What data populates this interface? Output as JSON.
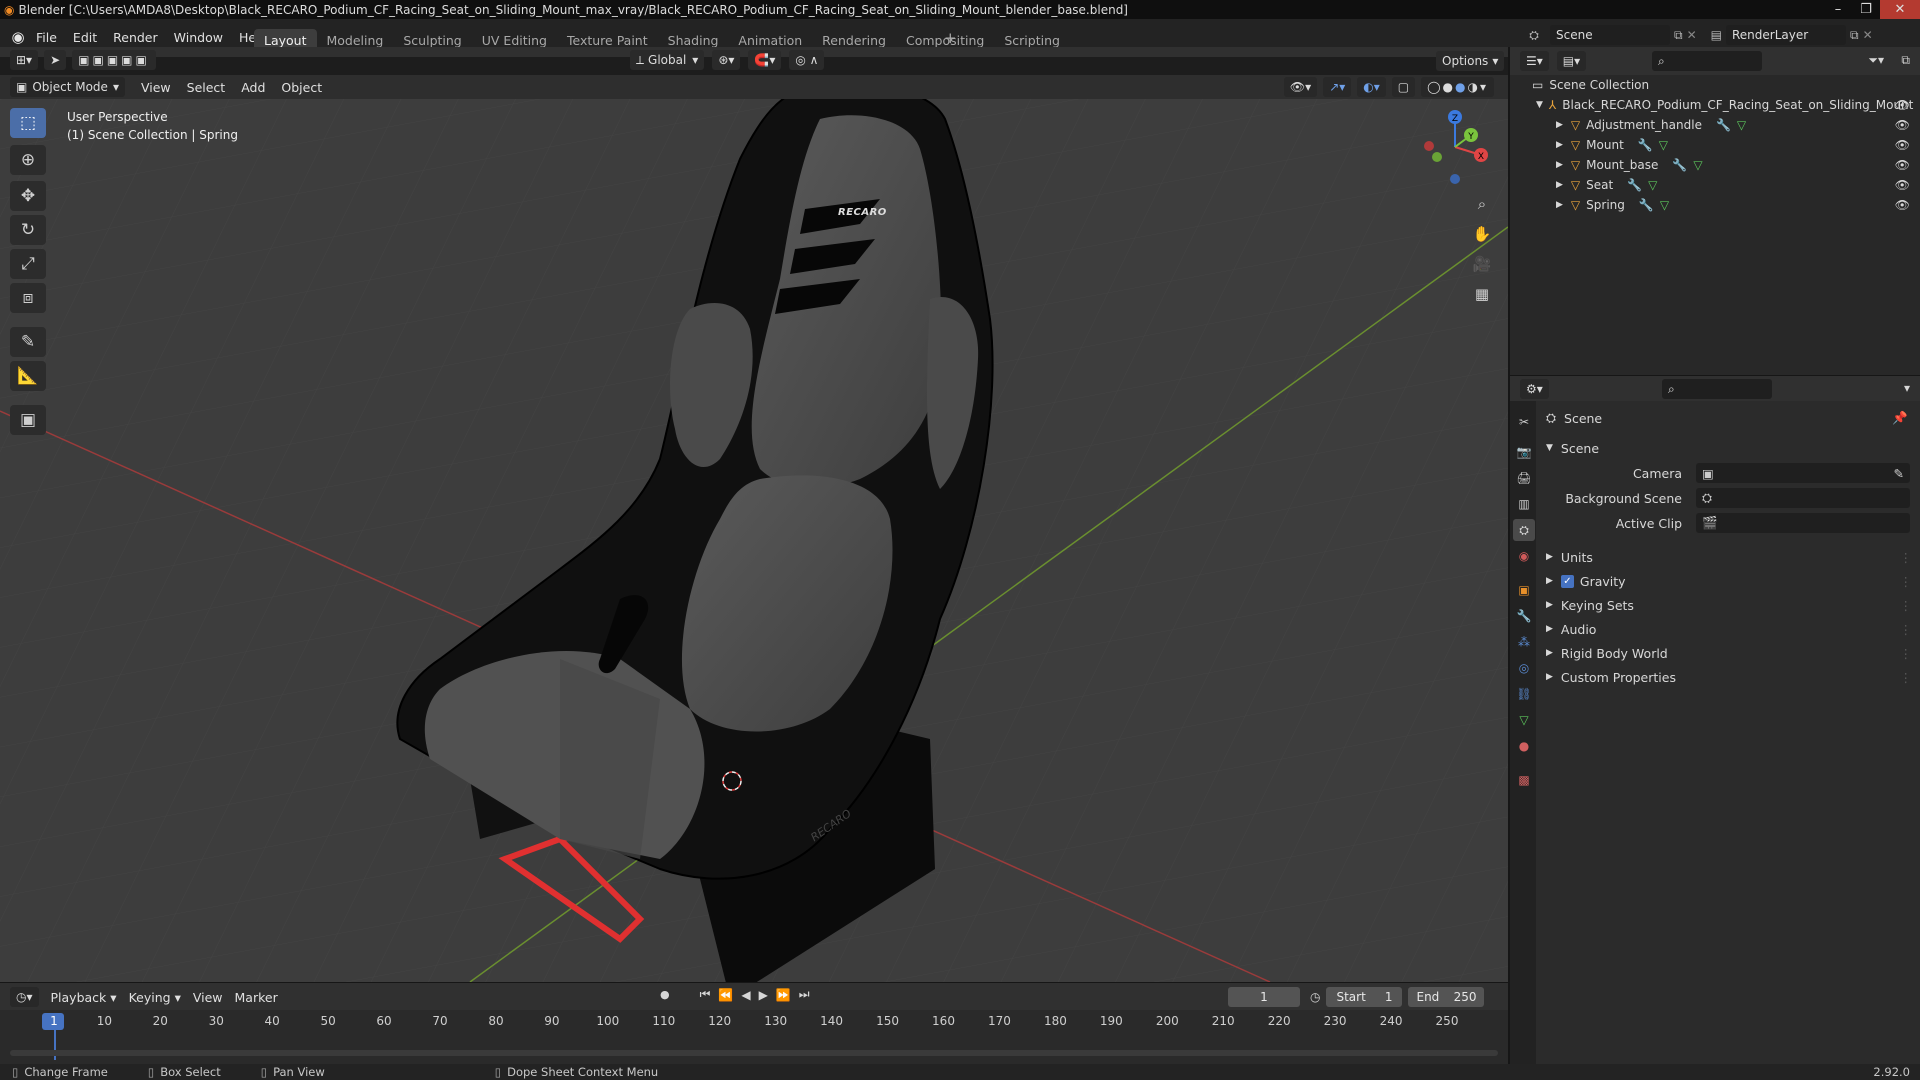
{
  "window": {
    "title": "Blender [C:\\Users\\AMDA8\\Desktop\\Black_RECARO_Podium_CF_Racing_Seat_on_Sliding_Mount_max_vray/Black_RECARO_Podium_CF_Racing_Seat_on_Sliding_Mount_blender_base.blend]"
  },
  "menu": [
    "File",
    "Edit",
    "Render",
    "Window",
    "Help"
  ],
  "workspaces": [
    "Layout",
    "Modeling",
    "Sculpting",
    "UV Editing",
    "Texture Paint",
    "Shading",
    "Animation",
    "Rendering",
    "Compositing",
    "Scripting"
  ],
  "active_workspace": "Layout",
  "scene_selector": {
    "label": "Scene"
  },
  "renderlayer_selector": {
    "label": "RenderLayer"
  },
  "viewport_header": {
    "mode": "Object Mode",
    "menus": [
      "View",
      "Select",
      "Add",
      "Object"
    ],
    "orientation": "Global",
    "options_label": "Options"
  },
  "viewport": {
    "perspective_label": "User Perspective",
    "collection_label": "(1) Scene Collection | Spring",
    "seat_logo": "RECARO",
    "side_logo": "RECARO",
    "gizmo": {
      "x": "X",
      "y": "Y",
      "z": "Z"
    }
  },
  "toolbar": [
    "select-box",
    "cursor",
    "move",
    "rotate",
    "scale",
    "transform",
    "annotate",
    "measure",
    "add-cube"
  ],
  "outliner": {
    "root": "Scene Collection",
    "collection": "Black_RECARO_Podium_CF_Racing_Seat_on_Sliding_Mount",
    "objects": [
      "Adjustment_handle",
      "Mount",
      "Mount_base",
      "Seat",
      "Spring"
    ]
  },
  "properties": {
    "context": "Scene",
    "panel": "Scene",
    "fields": [
      {
        "label": "Camera"
      },
      {
        "label": "Background Scene"
      },
      {
        "label": "Active Clip"
      }
    ],
    "sections": [
      {
        "label": "Units",
        "checkbox": false
      },
      {
        "label": "Gravity",
        "checkbox": true
      },
      {
        "label": "Keying Sets",
        "checkbox": false
      },
      {
        "label": "Audio",
        "checkbox": false
      },
      {
        "label": "Rigid Body World",
        "checkbox": false
      },
      {
        "label": "Custom Properties",
        "checkbox": false
      }
    ]
  },
  "timeline": {
    "menus": [
      "Playback",
      "Keying",
      "View",
      "Marker"
    ],
    "current_frame": "1",
    "start_label": "Start",
    "start": "1",
    "end_label": "End",
    "end": "250",
    "ticks": [
      "1",
      "10",
      "20",
      "30",
      "40",
      "50",
      "60",
      "70",
      "80",
      "90",
      "100",
      "110",
      "120",
      "130",
      "140",
      "150",
      "160",
      "170",
      "180",
      "190",
      "200",
      "210",
      "220",
      "230",
      "240",
      "250"
    ]
  },
  "statusbar": {
    "items": [
      "Change Frame",
      "Box Select",
      "Pan View",
      "Dope Sheet Context Menu"
    ],
    "version": "2.92.0"
  }
}
